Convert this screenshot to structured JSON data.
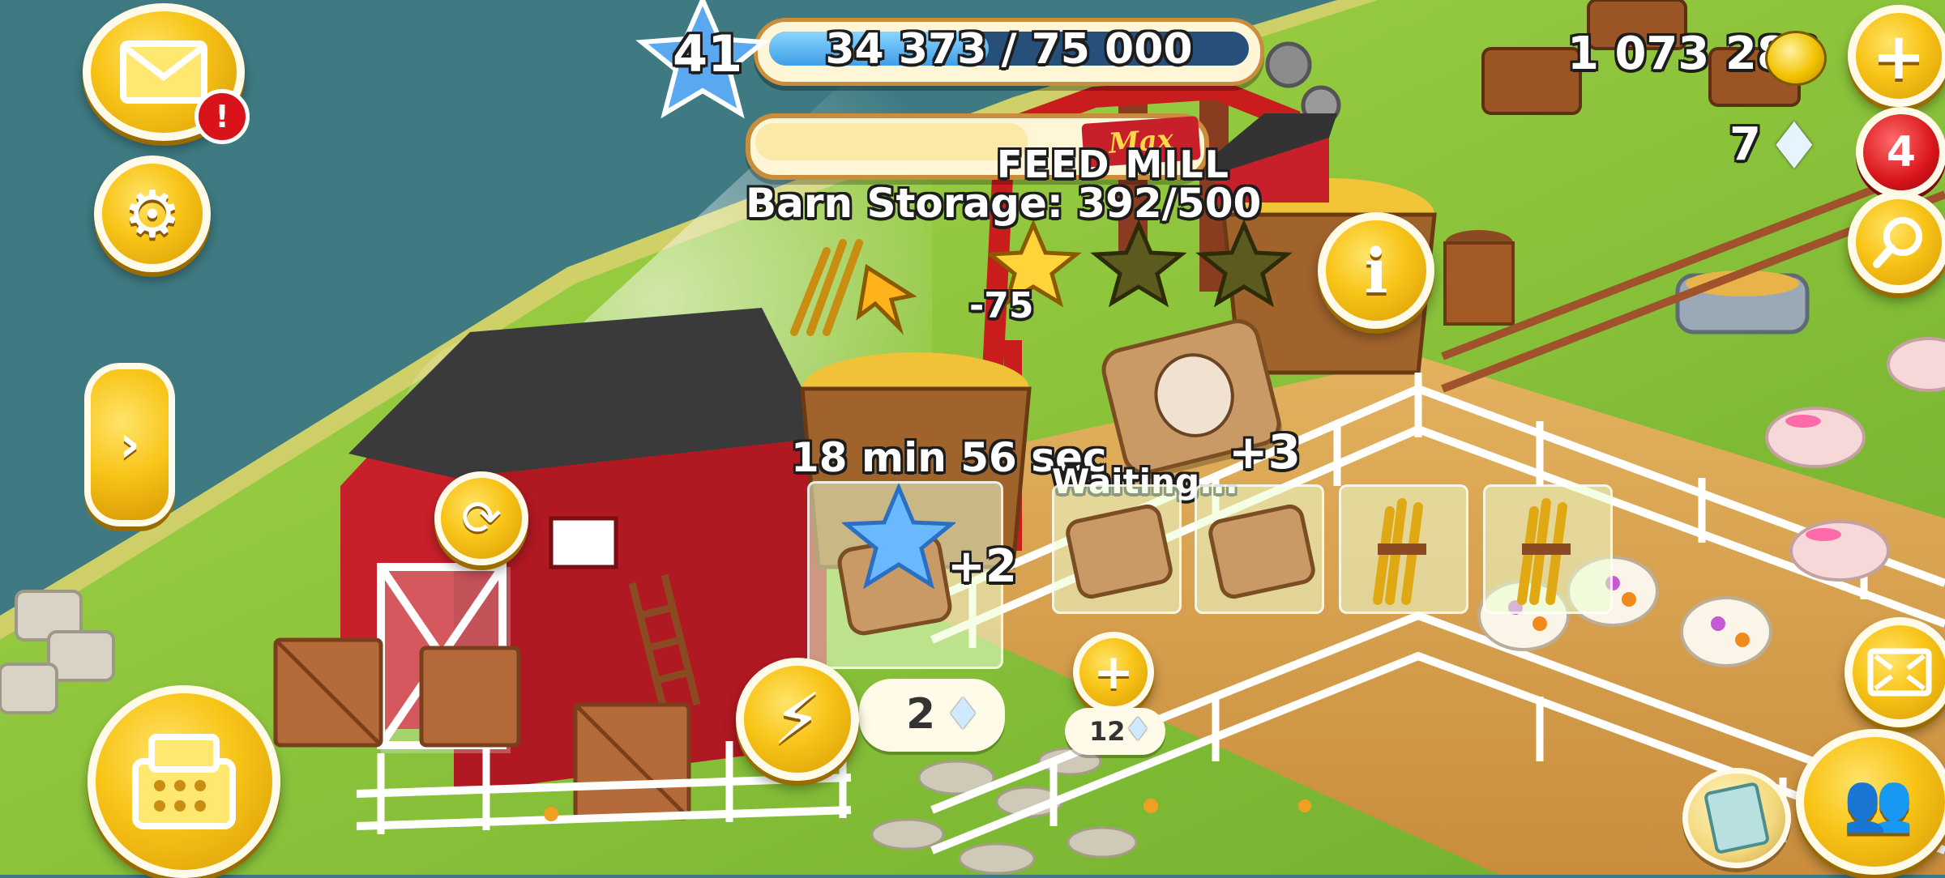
{
  "level": {
    "number": "41",
    "xp_text": "34 373 / 75 000",
    "xp_fraction": 0.458
  },
  "currency": {
    "coins": "1 073 283",
    "diamonds": "7"
  },
  "notifications": {
    "mail_badge": "!",
    "news_badge": "4"
  },
  "production": {
    "building_label": "FEED MILL",
    "max_badge": "Max",
    "barn_storage": "Barn Storage: 392/500",
    "consumed": "-75",
    "timer": "18 min 56 sec",
    "current_count": "+2",
    "queue_status": "Waiting...",
    "queue_count": "+3",
    "speedup_cost": "2",
    "extra_slot_cost": "12"
  },
  "colors": {
    "accent_yellow": "#f8c417",
    "barn_red": "#c8202a",
    "sky_water": "#3f7a82",
    "grass": "#8fc53a"
  },
  "icons": [
    "mail-icon",
    "gear-icon",
    "arrow-right-icon",
    "cash-register-icon",
    "plus-icon",
    "diamond-icon",
    "coin-icon",
    "magnifier-icon",
    "info-icon",
    "lightning-icon",
    "expand-icon",
    "friends-icon",
    "cards-icon",
    "refresh-icon",
    "star-icon"
  ]
}
